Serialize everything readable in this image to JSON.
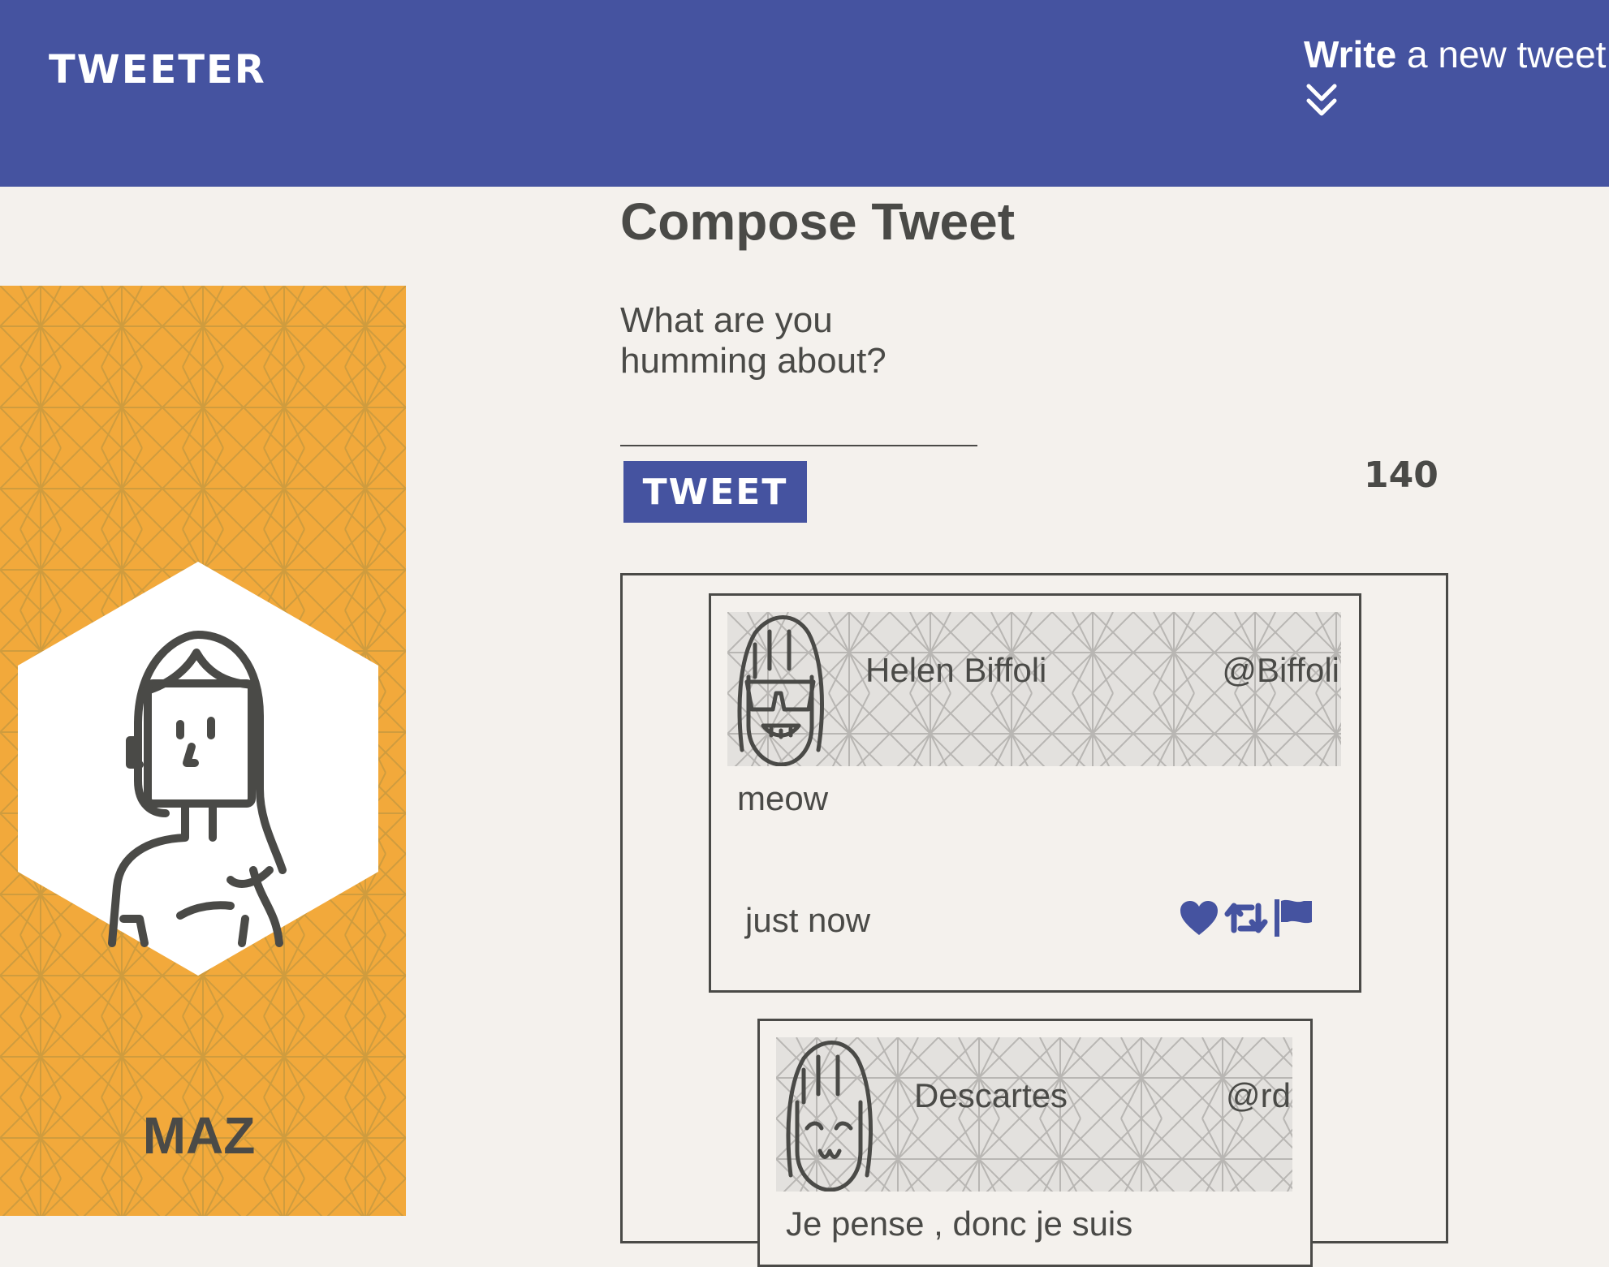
{
  "nav": {
    "brand": "TWEETER",
    "write_bold": "Write",
    "write_rest": " a new tweet"
  },
  "profile": {
    "name": "MAZ"
  },
  "compose": {
    "title": "Compose Tweet",
    "placeholder": "What are you humming about?",
    "button_label": "TWEET",
    "counter": "140"
  },
  "tweets": [
    {
      "name": "Helen Biffoli",
      "handle": "@Biffoli",
      "text": "meow",
      "time": "just now",
      "icons": [
        "heart-icon",
        "retweet-icon",
        "flag-icon"
      ]
    },
    {
      "name": "Descartes",
      "handle": "@rd",
      "text": "Je pense , donc je suis"
    }
  ],
  "colors": {
    "nav": "#4553a0",
    "background": "#f4f1ed",
    "profile": "#f2a93b",
    "text": "#4a4a47",
    "accent": "#4553a0"
  }
}
